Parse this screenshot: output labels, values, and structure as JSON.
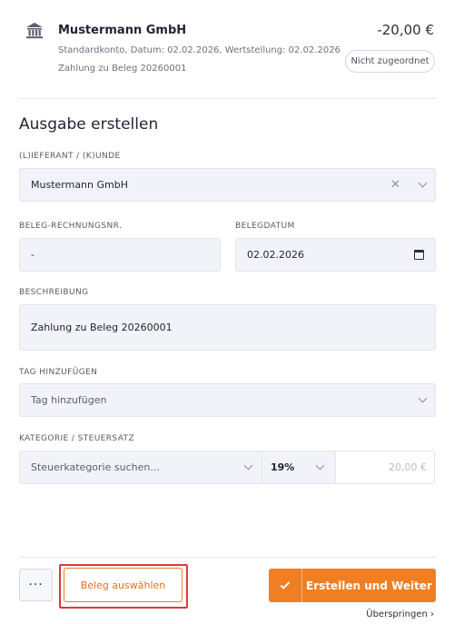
{
  "transaction": {
    "name": "Mustermann GmbH",
    "meta_line1": "Standardkonto, Datum: 02.02.2026, Wertstellung: 02.02.2026",
    "meta_line2": "Zahlung zu Beleg 20260001",
    "amount": "-20,00 €",
    "status_badge": "Nicht zugeordnet",
    "icon": "bank-icon"
  },
  "form": {
    "title": "Ausgabe erstellen",
    "supplier": {
      "label": "(L)IEFERANT / (K)UNDE",
      "value": "Mustermann GmbH",
      "clear_symbol": "✕"
    },
    "invoice_no": {
      "label": "BELEG-RECHNUNGSNR.",
      "value": "-"
    },
    "invoice_date": {
      "label": "BELEGDATUM",
      "value": "02.02.2026"
    },
    "description": {
      "label": "BESCHREIBUNG",
      "value": "Zahlung zu Beleg 20260001"
    },
    "tag": {
      "label": "TAG HINZUFÜGEN",
      "placeholder": "Tag hinzufügen"
    },
    "category": {
      "label": "KATEGORIE / STEUERSATZ",
      "search_placeholder": "Steuerkategorie suchen...",
      "tax_rate": "19%",
      "amount_placeholder": "20,00 €"
    }
  },
  "footer": {
    "more_label": "···",
    "select_receipt_label": "Beleg auswählen",
    "primary_label": "Erstellen und Weiter",
    "skip_label": "Überspringen ›"
  }
}
